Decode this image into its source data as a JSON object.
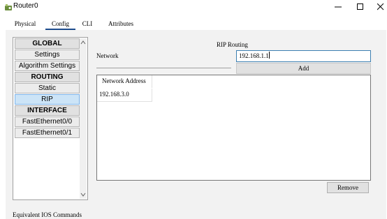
{
  "window": {
    "title": "Router0",
    "icon": "router-icon"
  },
  "tabs": [
    {
      "label": "Physical",
      "active": false
    },
    {
      "label": "Config",
      "active": true
    },
    {
      "label": "CLI",
      "active": false
    },
    {
      "label": "Attributes",
      "active": false
    }
  ],
  "sidebar": {
    "items": [
      {
        "label": "GLOBAL",
        "type": "header"
      },
      {
        "label": "Settings",
        "type": "item"
      },
      {
        "label": "Algorithm Settings",
        "type": "item"
      },
      {
        "label": "ROUTING",
        "type": "header"
      },
      {
        "label": "Static",
        "type": "item"
      },
      {
        "label": "RIP",
        "type": "item",
        "selected": true
      },
      {
        "label": "INTERFACE",
        "type": "header"
      },
      {
        "label": "FastEthernet0/0",
        "type": "item"
      },
      {
        "label": "FastEthernet0/1",
        "type": "item"
      }
    ]
  },
  "rip": {
    "title": "RIP Routing",
    "network_label": "Network",
    "network_value": "192.168.1.1",
    "add_label": "Add",
    "table_header": "Network Address",
    "networks": [
      "192.168.3.0"
    ],
    "remove_label": "Remove"
  },
  "footer": {
    "ios_label": "Equivalent IOS Commands"
  },
  "colors": {
    "selected_bg": "#cce4f7",
    "active_tab_underline": "#1c4b8c",
    "input_border": "#3c7fb1"
  }
}
